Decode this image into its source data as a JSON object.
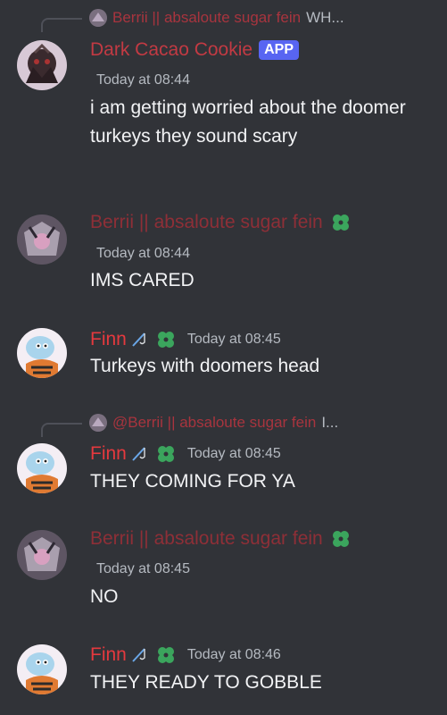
{
  "messages": [
    {
      "reply": {
        "name": "Berrii || absaloute sugar fein",
        "text": "WH..."
      },
      "author": "Dark Cacao Cookie",
      "badge": "APP",
      "time": "Today at 08:44",
      "content": "i am getting worried about the doomer turkeys they sound scary"
    },
    {
      "author": "Berrii || absaloute sugar fein",
      "time": "Today at 08:44",
      "content": "IMS CARED"
    },
    {
      "author": "Finn",
      "time": "Today at 08:45",
      "content": "Turkeys with doomers head"
    },
    {
      "reply": {
        "name": "@Berrii || absaloute sugar fein",
        "text": "I..."
      },
      "author": "Finn",
      "time": "Today at 08:45",
      "content": "THEY COMING FOR YA"
    },
    {
      "author": "Berrii || absaloute sugar fein",
      "time": "Today at 08:45",
      "content": "NO"
    },
    {
      "author": "Finn",
      "time": "Today at 08:46",
      "content": "THEY READY TO GOBBLE"
    }
  ],
  "icons": {
    "role_icon": "clover-icon",
    "fishing_icon": "fishing-rod-icon",
    "reply_line": "reply-spine"
  },
  "colors": {
    "background": "#313338",
    "dark_cacao_name": "#c23a43",
    "berrii_name": "#8e2f37",
    "finn_name": "#e5393e",
    "app_badge": "#5865f2",
    "clover": "#3ba55d"
  }
}
